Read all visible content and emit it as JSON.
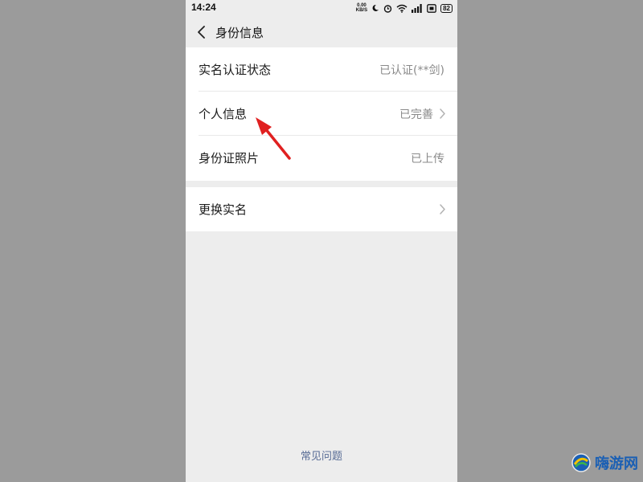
{
  "statusbar": {
    "time": "14:24",
    "net_speed_value": "0.00",
    "net_speed_unit": "KB/S",
    "battery": "82",
    "icons": [
      "net-speed-icon",
      "moon-icon",
      "alarm-icon",
      "wifi-icon",
      "signal-icon",
      "sim-icon",
      "battery-icon"
    ]
  },
  "navbar": {
    "title": "身份信息",
    "back_icon": "chevron-left-icon"
  },
  "groups": [
    {
      "rows": [
        {
          "label": "实名认证状态",
          "value": "已认证(**剑)",
          "chevron": false
        },
        {
          "label": "个人信息",
          "value": "已完善",
          "chevron": true
        },
        {
          "label": "身份证照片",
          "value": "已上传",
          "chevron": false
        }
      ]
    },
    {
      "rows": [
        {
          "label": "更换实名",
          "value": "",
          "chevron": true
        }
      ]
    }
  ],
  "footer": {
    "faq_label": "常见问题"
  },
  "annotation": {
    "arrow_color": "#e02020",
    "icon": "red-arrow-icon"
  },
  "watermark": {
    "text": "嗨游网",
    "icon": "logo-icon",
    "color": "#1a5fb4"
  },
  "colors": {
    "background": "#ededed",
    "link": "#576b95"
  }
}
